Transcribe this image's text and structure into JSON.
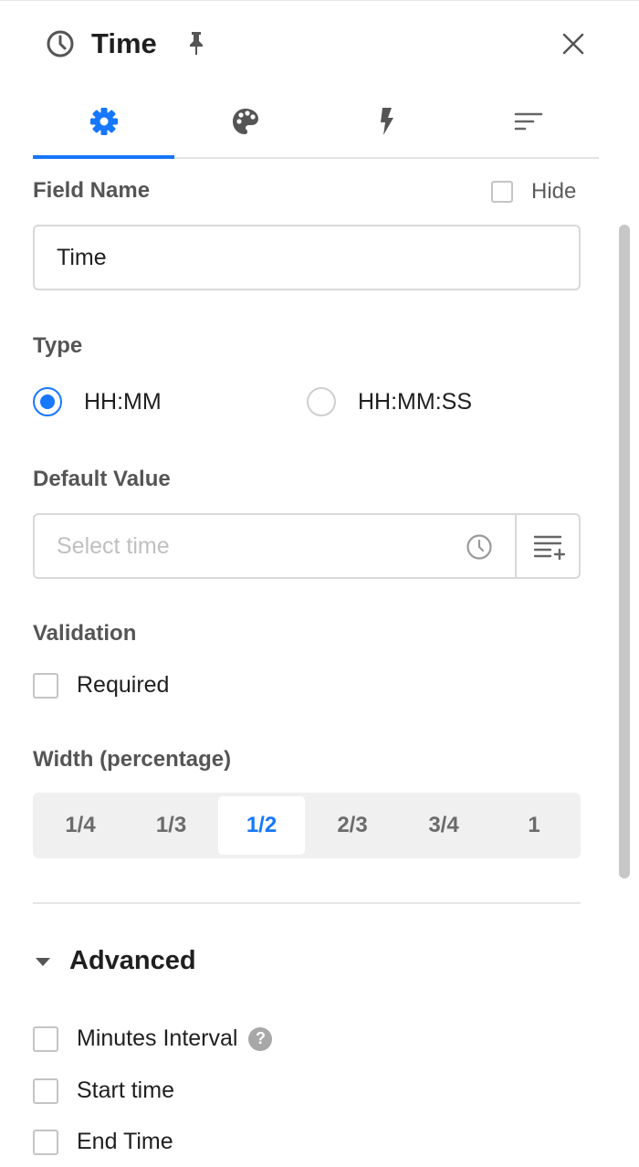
{
  "header": {
    "title": "Time",
    "close_label": "×"
  },
  "tabs": [
    {
      "name": "settings",
      "icon": "gear-icon"
    },
    {
      "name": "style",
      "icon": "palette-icon"
    },
    {
      "name": "actions",
      "icon": "lightning-icon"
    },
    {
      "name": "sort",
      "icon": "sort-icon"
    }
  ],
  "active_tab": "settings",
  "field_name": {
    "label": "Field Name",
    "value": "Time",
    "hide_label": "Hide",
    "hide_checked": false
  },
  "type": {
    "label": "Type",
    "options": [
      {
        "label": "HH:MM",
        "checked": true
      },
      {
        "label": "HH:MM:SS",
        "checked": false
      }
    ]
  },
  "default_value": {
    "label": "Default Value",
    "placeholder": "Select time"
  },
  "validation": {
    "label": "Validation",
    "required_label": "Required",
    "required_checked": false
  },
  "width": {
    "label": "Width (percentage)",
    "options": [
      "1/4",
      "1/3",
      "1/2",
      "2/3",
      "3/4",
      "1"
    ],
    "selected": "1/2"
  },
  "advanced": {
    "title": "Advanced",
    "options": [
      {
        "label": "Minutes Interval",
        "has_help": true,
        "checked": false
      },
      {
        "label": "Start time",
        "has_help": false,
        "checked": false
      },
      {
        "label": "End Time",
        "has_help": false,
        "checked": false
      }
    ],
    "help_glyph": "?"
  },
  "colors": {
    "accent": "#1677ff",
    "label_gray": "#555555",
    "border": "#d9d9d9"
  }
}
